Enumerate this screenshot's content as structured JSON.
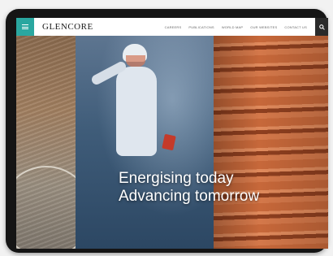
{
  "header": {
    "logo_text": "GLENCORE",
    "nav_links": [
      "CAREERS",
      "PUBLICATIONS",
      "WORLD MAP",
      "OUR WEBSITES",
      "CONTACT US"
    ],
    "menu_icon": "hamburger-icon",
    "search_icon": "search-icon"
  },
  "hero": {
    "line1": "Energising today",
    "line2": "Advancing tomorrow"
  },
  "colors": {
    "accent": "#2aa7a0",
    "header_bg": "#ffffff",
    "device_frame": "#151515"
  }
}
